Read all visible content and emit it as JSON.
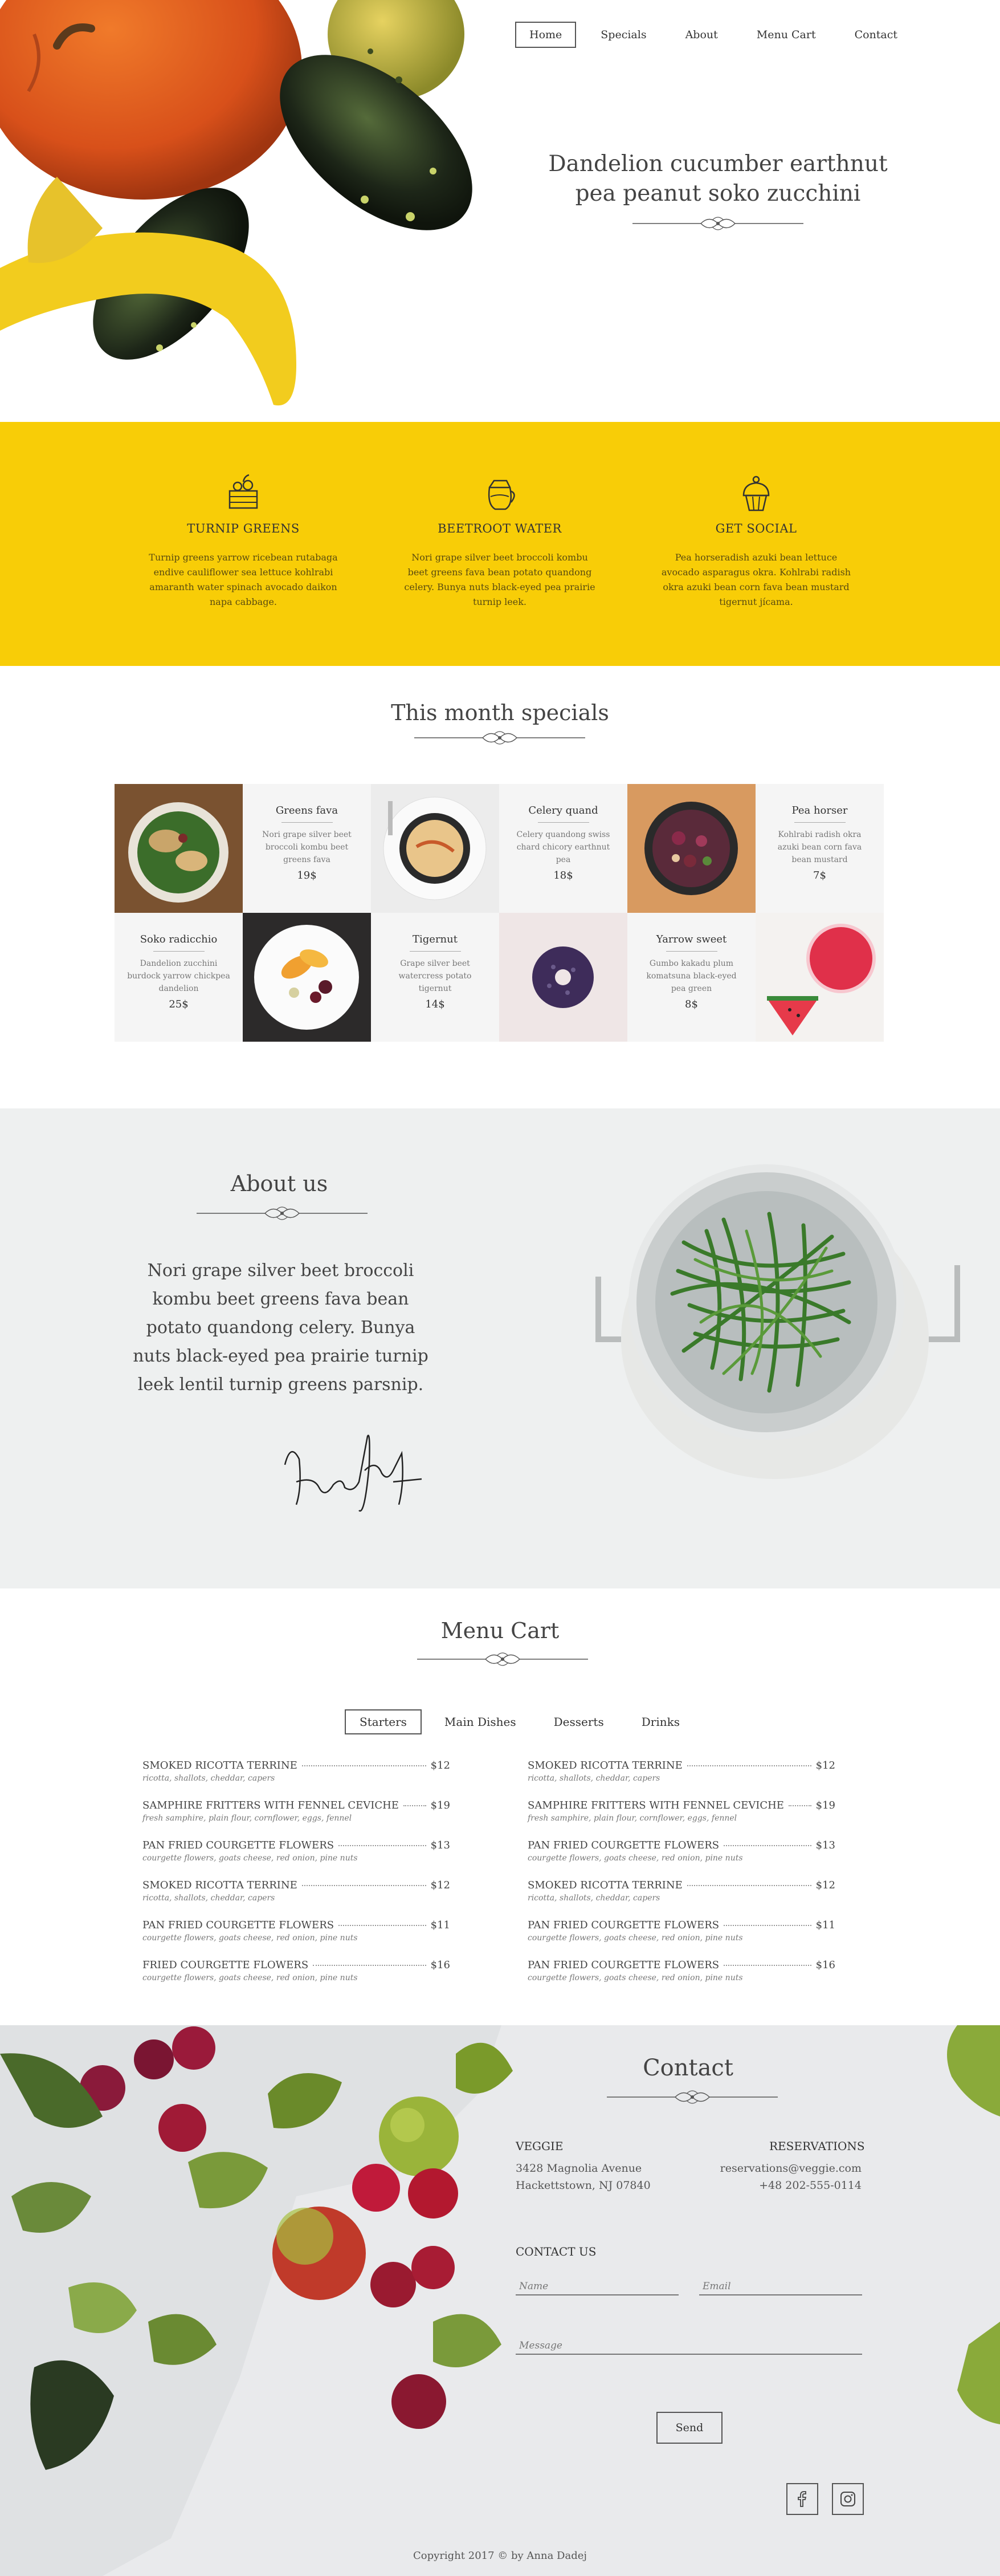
{
  "nav": {
    "items": [
      {
        "label": "Home",
        "active": true
      },
      {
        "label": "Specials",
        "active": false
      },
      {
        "label": "About",
        "active": false
      },
      {
        "label": "Menu Cart",
        "active": false
      },
      {
        "label": "Contact",
        "active": false
      }
    ]
  },
  "hero": {
    "title_line1": "Dandelion cucumber earthnut",
    "title_line2": "pea peanut soko zucchini"
  },
  "features": [
    {
      "icon": "basket-icon",
      "title": "TURNIP GREENS",
      "text": "Turnip greens yarrow ricebean rutabaga endive cauliflower sea lettuce kohlrabi amaranth water spinach avocado daikon napa cabbage."
    },
    {
      "icon": "jug-icon",
      "title": "BEETROOT WATER",
      "text": "Nori grape silver beet broccoli kombu beet greens fava bean potato quandong celery. Bunya nuts black-eyed pea prairie turnip leek."
    },
    {
      "icon": "cupcake-icon",
      "title": "GET SOCIAL",
      "text": "Pea horseradish azuki bean lettuce avocado asparagus okra. Kohlrabi radish okra azuki bean corn fava bean mustard tigernut jícama."
    }
  ],
  "specials": {
    "title": "This month specials",
    "items": [
      {
        "name": "Greens fava",
        "desc": "Nori grape silver beet broccoli kombu beet greens fava",
        "price": "19$"
      },
      {
        "name": "Celery quand",
        "desc": "Celery quandong swiss chard chicory earthnut pea",
        "price": "18$"
      },
      {
        "name": "Pea horser",
        "desc": "Kohlrabi radish okra azuki bean corn fava bean mustard",
        "price": "7$"
      },
      {
        "name": "Soko radicchio",
        "desc": "Dandelion zucchini burdock yarrow chickpea dandelion",
        "price": "25$"
      },
      {
        "name": "Tigernut",
        "desc": "Grape silver beet watercress potato tigernut",
        "price": "14$"
      },
      {
        "name": "Yarrow sweet",
        "desc": "Gumbo kakadu plum komatsuna black-eyed pea green",
        "price": "8$"
      }
    ]
  },
  "about": {
    "title": "About us",
    "text": "Nori grape silver beet broccoli kombu beet greens fava bean potato quandong celery. Bunya nuts black-eyed pea prairie turnip leek lentil turnip greens parsnip."
  },
  "menu": {
    "title": "Menu Cart",
    "tabs": [
      {
        "label": "Starters",
        "active": true
      },
      {
        "label": "Main Dishes",
        "active": false
      },
      {
        "label": "Desserts",
        "active": false
      },
      {
        "label": "Drinks",
        "active": false
      }
    ],
    "left": [
      {
        "name": "SMOKED RICOTTA TERRINE",
        "price": "$12",
        "ing": "ricotta, shallots, cheddar, capers"
      },
      {
        "name": "SAMPHIRE FRITTERS WITH FENNEL CEVICHE",
        "price": "$19",
        "ing": "fresh samphire, plain flour, cornflower, eggs, fennel"
      },
      {
        "name": "PAN FRIED COURGETTE FLOWERS",
        "price": "$13",
        "ing": "courgette flowers, goats cheese, red onion, pine nuts"
      },
      {
        "name": "SMOKED RICOTTA TERRINE",
        "price": "$12",
        "ing": "ricotta, shallots, cheddar, capers"
      },
      {
        "name": "PAN FRIED COURGETTE FLOWERS",
        "price": "$11",
        "ing": "courgette flowers, goats cheese, red onion, pine nuts"
      },
      {
        "name": "FRIED COURGETTE FLOWERS",
        "price": "$16",
        "ing": "courgette flowers, goats cheese, red onion, pine nuts"
      }
    ],
    "right": [
      {
        "name": "SMOKED RICOTTA TERRINE",
        "price": "$12",
        "ing": "ricotta, shallots, cheddar, capers"
      },
      {
        "name": "SAMPHIRE FRITTERS WITH FENNEL CEVICHE",
        "price": "$19",
        "ing": "fresh samphire, plain flour, cornflower, eggs, fennel"
      },
      {
        "name": "PAN FRIED COURGETTE FLOWERS",
        "price": "$13",
        "ing": "courgette flowers, goats cheese, red onion, pine nuts"
      },
      {
        "name": "SMOKED RICOTTA TERRINE",
        "price": "$12",
        "ing": "ricotta, shallots, cheddar, capers"
      },
      {
        "name": "PAN FRIED COURGETTE FLOWERS",
        "price": "$11",
        "ing": "courgette flowers, goats cheese, red onion, pine nuts"
      },
      {
        "name": "PAN FRIED COURGETTE FLOWERS",
        "price": "$16",
        "ing": "courgette flowers, goats cheese, red onion, pine nuts"
      }
    ]
  },
  "contact": {
    "title": "Contact",
    "veggie_head": "VEGGIE",
    "address1": "3428 Magnolia Avenue",
    "address2": "Hackettstown, NJ 07840",
    "res_head": "RESERVATIONS",
    "email": "reservations@veggie.com",
    "phone": "+48 202-555-0114",
    "contact_us": "CONTACT US",
    "name_placeholder": "Name",
    "email_placeholder": "Email",
    "message_placeholder": "Message",
    "send": "Send"
  },
  "social": [
    "facebook-icon",
    "instagram-icon"
  ],
  "footer": {
    "copyright": "Copyright 2017 © by Anna Dadej"
  },
  "colors": {
    "accent_yellow": "#f8cd07",
    "gray_bg": "#eef0f0",
    "text": "#444444"
  }
}
